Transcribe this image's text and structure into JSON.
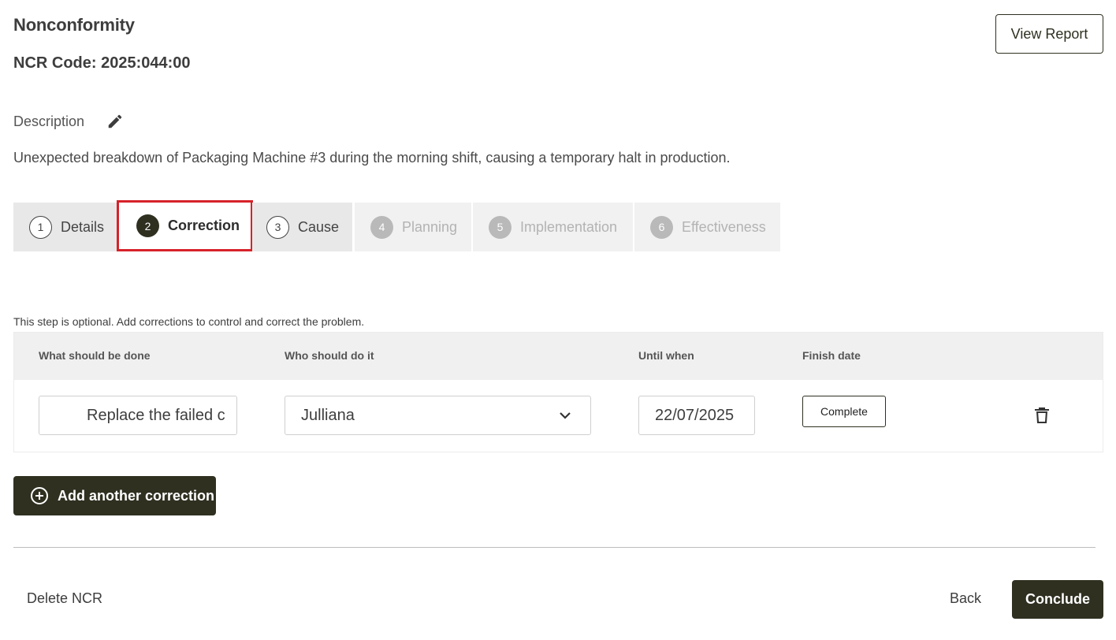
{
  "header": {
    "title": "Nonconformity",
    "ncr_code": "NCR Code: 2025:044:00",
    "view_report_label": "View Report"
  },
  "description": {
    "label": "Description",
    "text": "Unexpected breakdown of Packaging Machine #3 during the morning shift, causing a temporary halt in production."
  },
  "steps": [
    {
      "number": "1",
      "label": "Details",
      "state": "done"
    },
    {
      "number": "2",
      "label": "Correction",
      "state": "active"
    },
    {
      "number": "3",
      "label": "Cause",
      "state": "done"
    },
    {
      "number": "4",
      "label": "Planning",
      "state": "disabled"
    },
    {
      "number": "5",
      "label": "Implementation",
      "state": "disabled"
    },
    {
      "number": "6",
      "label": "Effectiveness",
      "state": "disabled"
    }
  ],
  "correction": {
    "hint": "This step is optional. Add corrections to control and correct the problem.",
    "columns": [
      "What should be done",
      "Who should do it",
      "Until when",
      "Finish date"
    ],
    "rows": [
      {
        "what": "Replace the failed c",
        "who": "Julliana",
        "until": "22/07/2025",
        "finish_button": "Complete"
      }
    ],
    "add_label": "Add another correction"
  },
  "footer": {
    "delete_label": "Delete NCR",
    "back_label": "Back",
    "conclude_label": "Conclude"
  },
  "colors": {
    "primary": "#2f3020",
    "highlight": "#d7222a"
  }
}
